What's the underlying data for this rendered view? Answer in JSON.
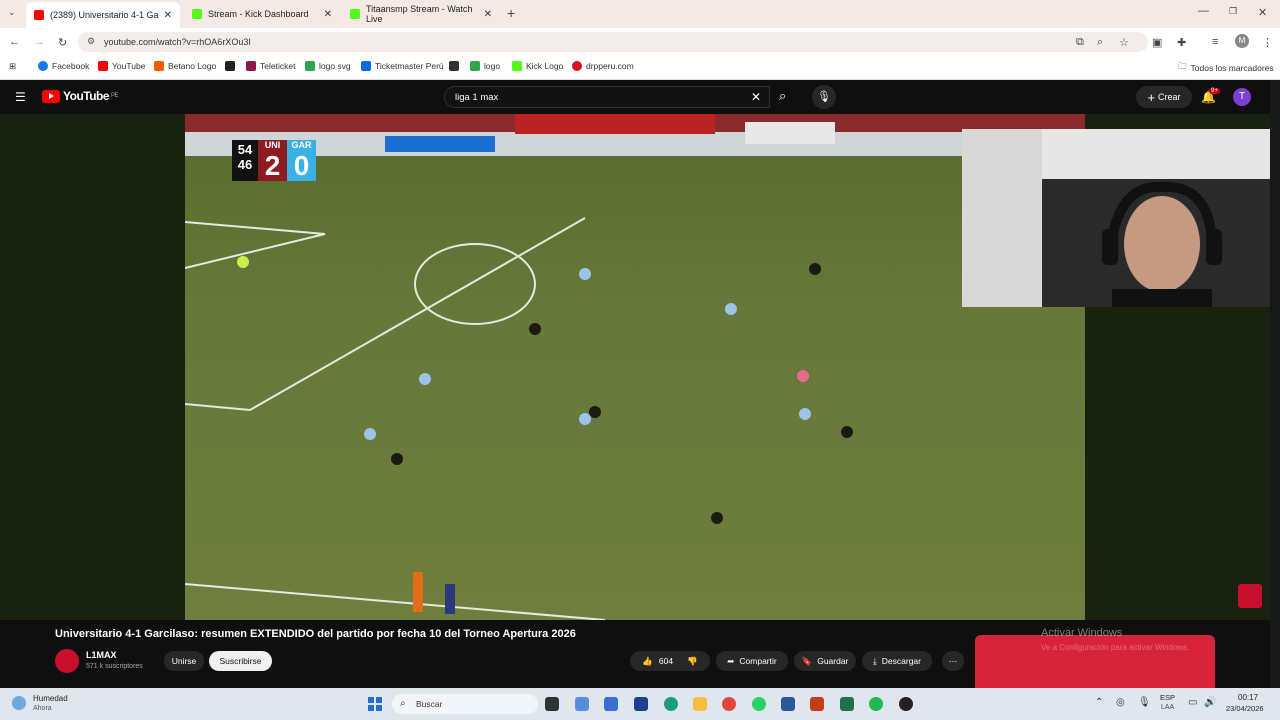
{
  "browser": {
    "tabs": [
      {
        "label": "(2389) Universitario 4-1 Ga",
        "active": true,
        "color": "#ff0000"
      },
      {
        "label": "Stream - Kick Dashboard",
        "active": false,
        "color": "#53fc18"
      },
      {
        "label": "Titaansmp Stream - Watch Live",
        "active": false,
        "color": "#53fc18"
      }
    ],
    "new_tab": "+",
    "url": "youtube.com/watch?v=rhOA6rXOu3I",
    "bookmarks": [
      {
        "label": "Facebook",
        "color": "#1877f2"
      },
      {
        "label": "YouTube",
        "color": "#ff0000"
      },
      {
        "label": "Betano Logo",
        "color": "#ff5a00"
      },
      {
        "label": "",
        "color": "#222222"
      },
      {
        "label": "Teleticket",
        "color": "#8b1a4a"
      },
      {
        "label": "logo svg",
        "color": "#2ea44f"
      },
      {
        "label": "Ticketmaster Perú",
        "color": "#026cdf"
      },
      {
        "label": "",
        "color": "#333333"
      },
      {
        "label": "logo",
        "color": "#2ea44f"
      },
      {
        "label": "Kick Logo",
        "color": "#53fc18"
      },
      {
        "label": "drpperu.com",
        "color": "#d91023"
      }
    ],
    "all_bookmarks": "Todos los marcadores"
  },
  "youtube": {
    "logo_text": "YouTube",
    "region": "PE",
    "search_value": "liga 1 max",
    "create_label": "Crear",
    "notif_badge": "9+",
    "user_initial": "T"
  },
  "scoreboard": {
    "time_min": "54",
    "time_sec": "46",
    "home_abbr": "UNI",
    "home_score": "2",
    "away_abbr": "GAR",
    "away_score": "0"
  },
  "video": {
    "title": "Universitario 4-1 Garcilaso: resumen EXTENDIDO del partido por fecha 10 del Torneo Apertura 2026",
    "channel": "L1MAX",
    "subscribers": "571 k suscriptores",
    "join_label": "Unirse",
    "subscribe_label": "Suscribirse",
    "likes": "604",
    "share_label": "Compartir",
    "save_label": "Guardar",
    "download_label": "Descargar"
  },
  "windows": {
    "watermark_title": "Activar Windows",
    "watermark_sub": "Ve a Configuración para activar Windows.",
    "weather_title": "Humedad",
    "weather_sub": "Ahora",
    "search_placeholder": "Buscar",
    "lang": "ESP",
    "lang_sub": "LAA",
    "time": "00:17",
    "date": "23/04/2026"
  }
}
